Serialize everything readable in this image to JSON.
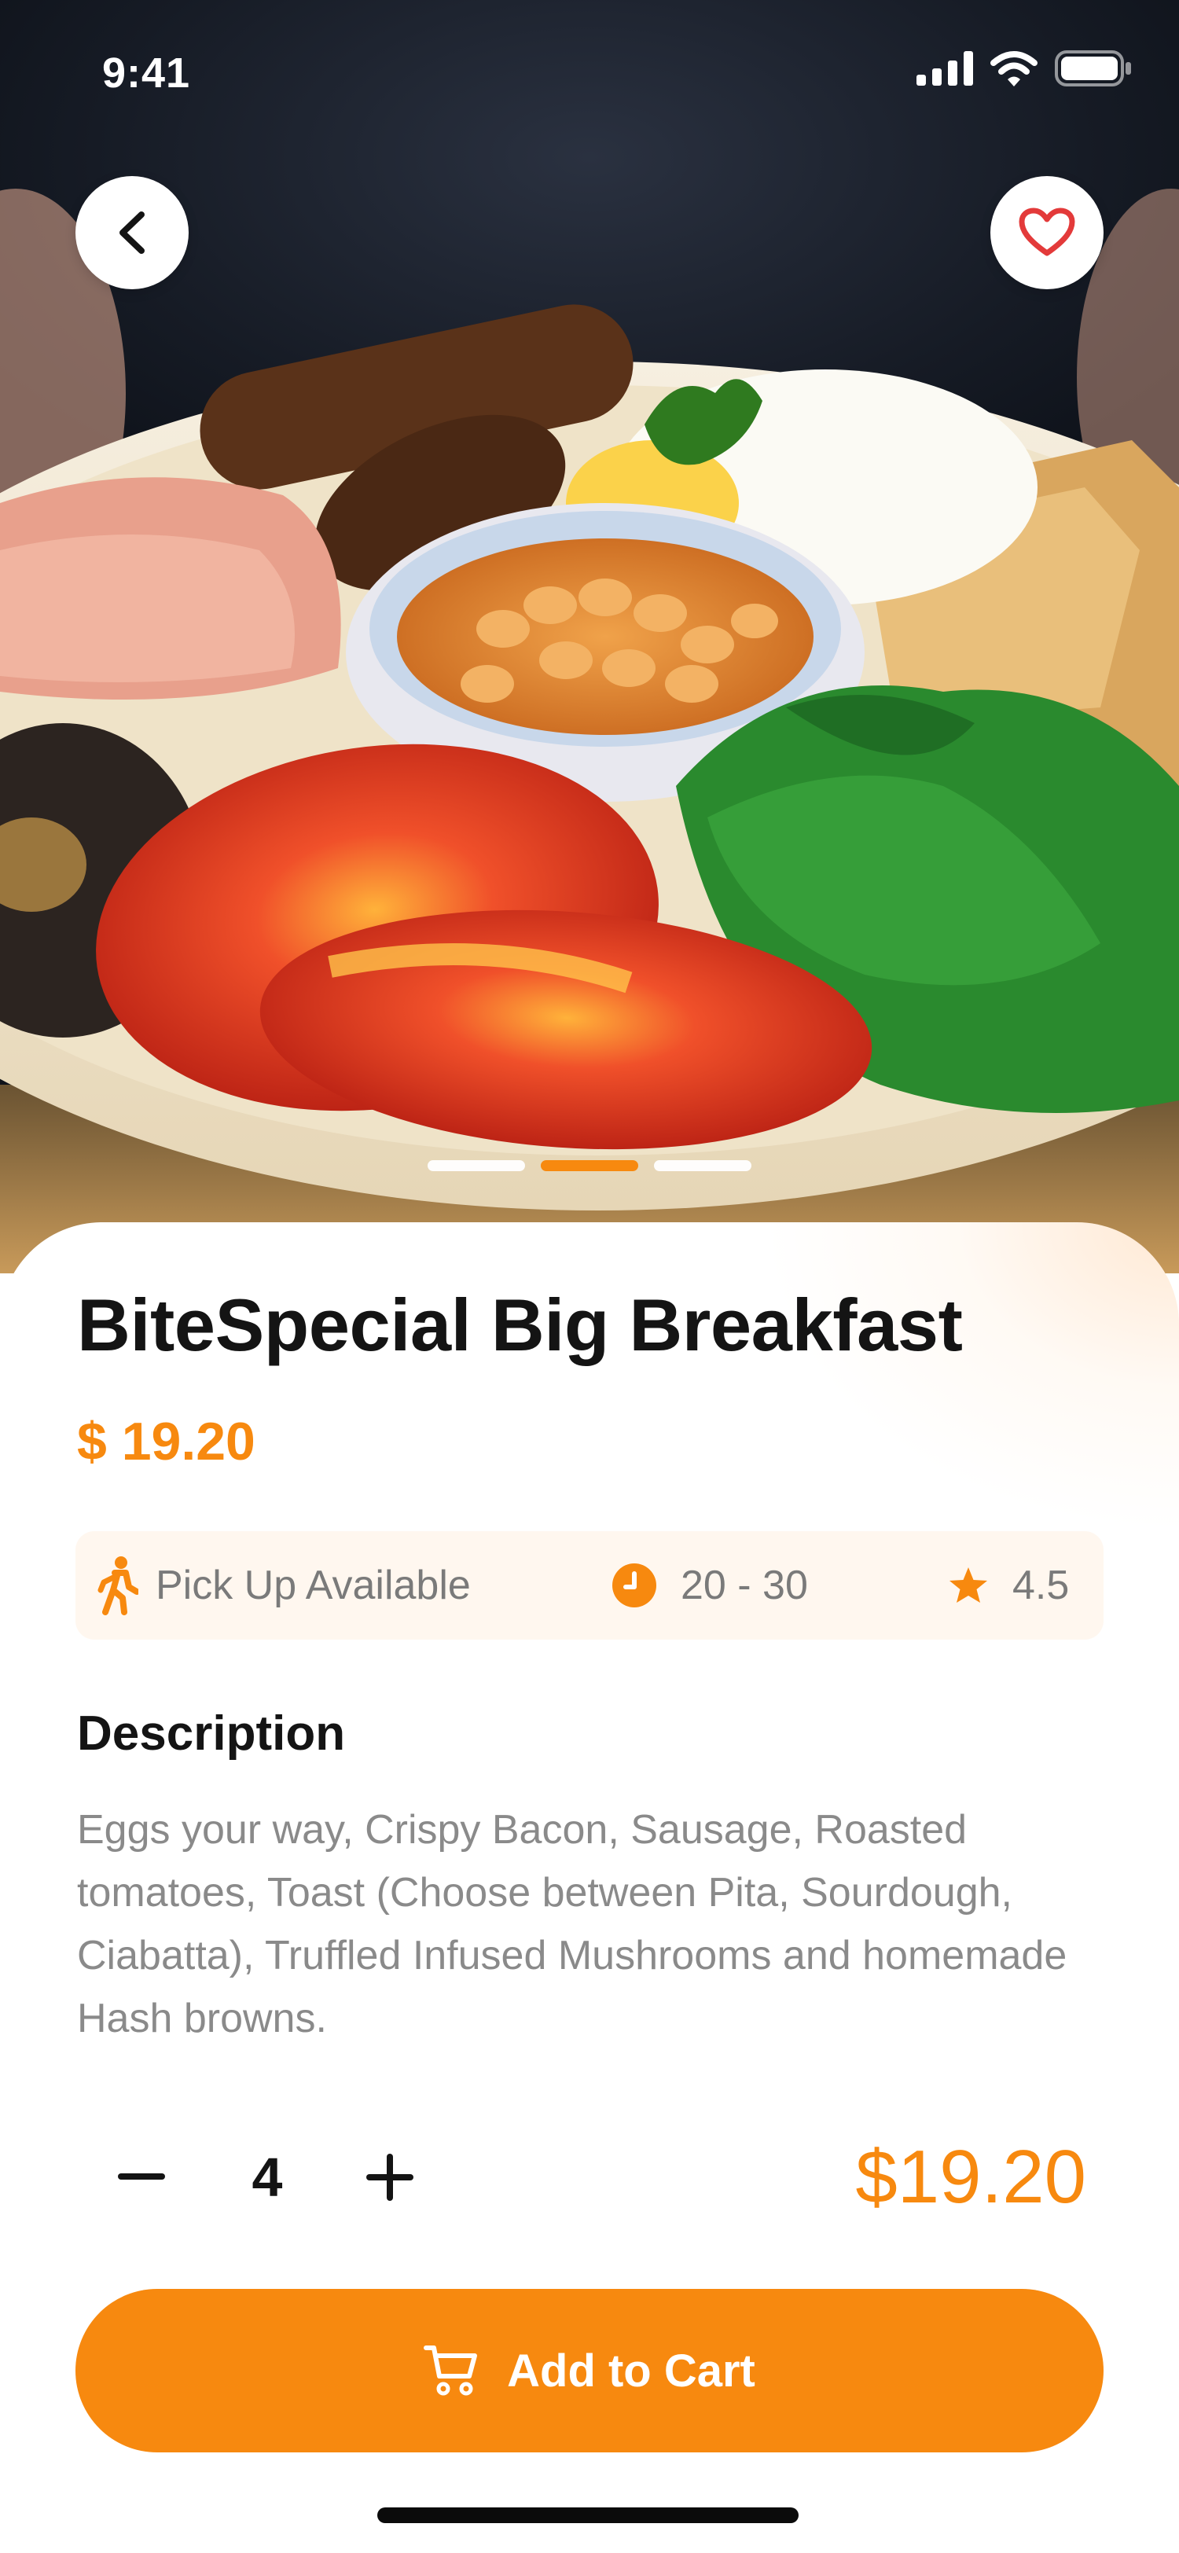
{
  "status_bar": {
    "time": "9:41"
  },
  "hero": {
    "carousel_active_index": 1,
    "carousel_count": 3
  },
  "product": {
    "title": "BiteSpecial Big Breakfast",
    "price": "$ 19.20"
  },
  "info": {
    "pickup": "Pick Up Available",
    "time_range": "20 - 30",
    "rating": "4.5"
  },
  "description": {
    "heading": "Description",
    "text": "Eggs your way, Crispy Bacon, Sausage, Roasted tomatoes, Toast (Choose between Pita, Sourdough, Ciabatta), Truffled Infused Mushrooms and homemade Hash browns."
  },
  "quantity": {
    "value": "4"
  },
  "total": "$19.20",
  "cart": {
    "label": "Add to Cart"
  },
  "colors": {
    "accent": "#f7890f",
    "text": "#141414",
    "muted": "#8a8a8a"
  },
  "icons": [
    "chevron-left-icon",
    "heart-icon",
    "walking-person-icon",
    "clock-icon",
    "star-icon",
    "minus-icon",
    "plus-icon",
    "cart-icon",
    "signal-icon",
    "wifi-icon",
    "battery-icon"
  ]
}
